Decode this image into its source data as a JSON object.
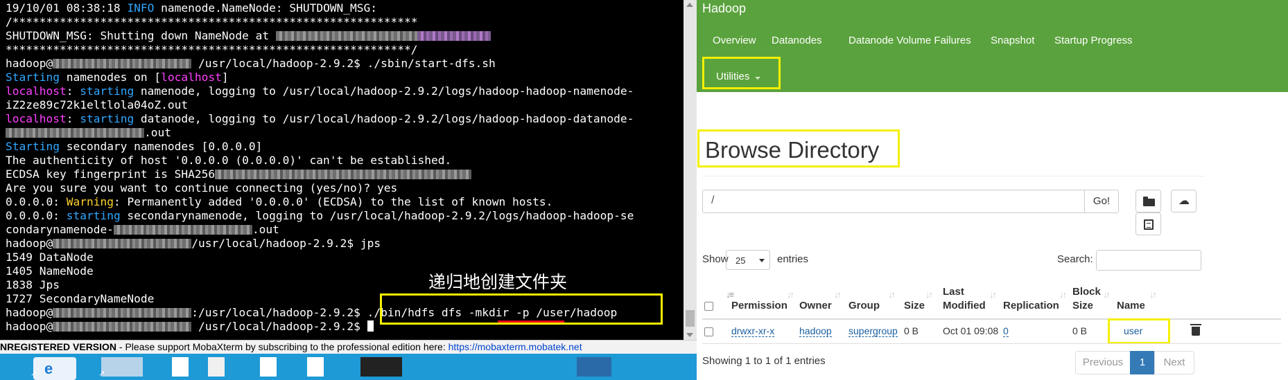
{
  "terminal": {
    "lines": {
      "l1": {
        "pre": "19/10/01 08:38:18 ",
        "info": "INFO",
        "rest": " namenode.NameNode: SHUTDOWN_MSG:"
      },
      "l2": "/************************************************************",
      "l3": "SHUTDOWN_MSG: Shutting down NameNode at ",
      "l4": "************************************************************/",
      "l5": {
        "user": "hadoop@",
        "path": " /usr/local/hadoop-2.9.2$ ./sbin/start-dfs.sh"
      },
      "l6": {
        "starting": "Starting",
        "mid": " namenodes on [",
        "host": "localhost",
        "end": "]"
      },
      "l7": {
        "host": "localhost",
        "sep": ": ",
        "starting": "starting",
        "rest": " namenode, logging to /usr/local/hadoop-2.9.2/logs/hadoop-hadoop-namenode-"
      },
      "l8": "iZ2ze89c72k1eltlola04oZ.out",
      "l9": {
        "host": "localhost",
        "sep": ": ",
        "starting": "starting",
        "rest": " datanode, logging to /usr/local/hadoop-2.9.2/logs/hadoop-hadoop-datanode-"
      },
      "l10": ".out",
      "l11": {
        "starting": "Starting",
        "rest": " secondary namenodes [0.0.0.0]"
      },
      "l12": "The authenticity of host '0.0.0.0 (0.0.0.0)' can't be established.",
      "l13": "ECDSA key fingerprint is SHA256",
      "l14": "Are you sure you want to continue connecting (yes/no)? yes",
      "l15": {
        "pre": "0.0.0.0: ",
        "warning": "Warning",
        "rest": ": Permanently added '0.0.0.0' (ECDSA) to the list of known hosts."
      },
      "l16": {
        "pre": "0.0.0.0: ",
        "starting": "starting",
        "rest": " secondarynamenode, logging to /usr/local/hadoop-2.9.2/logs/hadoop-hadoop-se"
      },
      "l17": {
        "pre": "condarynamenode-",
        "rest": ".out"
      },
      "l18": {
        "user": "hadoop@",
        "path": "/usr/local/hadoop-2.9.2$ jps"
      },
      "l19": "1549 DataNode",
      "l20": "1405 NameNode",
      "l21": "1838 Jps",
      "l22": "1727 SecondaryNameNode",
      "l23": {
        "user": "hadoop@",
        "path": ":/usr/local/hadoop-2.9.2$ ./bin/hdfs dfs -mkdir -p /user/hadoop"
      },
      "l24": {
        "user": "hadoop@",
        "path": " /usr/local/hadoop-2.9.2$ "
      }
    },
    "annotation": "递归地创建文件夹"
  },
  "status_bar": {
    "unregistered": "NREGISTERED VERSION",
    "message": "  -  Please support MobaXterm by subscribing to the professional edition here:  ",
    "url": "https://mobaxterm.mobatek.net"
  },
  "hadoop": {
    "brand": "Hadoop",
    "nav": [
      "Overview",
      "Datanodes",
      "Datanode Volume Failures",
      "Snapshot",
      "Startup Progress"
    ],
    "utilities": "Utilities",
    "page_title": "Browse Directory",
    "path_value": "/",
    "go_label": "Go!",
    "show_label": "Show",
    "entries_value": "25",
    "entries_label": "entries",
    "search_label": "Search:",
    "columns": {
      "permission": "Permission",
      "owner": "Owner",
      "group": "Group",
      "size": "Size",
      "last": "Last",
      "modified": "Modified",
      "replication": "Replication",
      "block": "Block",
      "block_size": "Size",
      "name": "Name"
    },
    "row": {
      "permission": "drwxr-xr-x",
      "owner": "hadoop",
      "group": "supergroup",
      "size": "0 B",
      "modified": "Oct 01 09:08",
      "replication": "0",
      "block_size": "0 B",
      "name": "user"
    },
    "info": "Showing 1 to 1 of 1 entries",
    "pagination": {
      "previous": "Previous",
      "page": "1",
      "next": "Next"
    }
  },
  "colors": {
    "navbar": "#5aa23d",
    "highlight": "#f5f000",
    "terminal_cyan": "#31a8ff",
    "terminal_magenta": "#ff40ff",
    "terminal_yellow": "#ffd42a",
    "link_blue": "#1a5fa0"
  },
  "icons": [
    "new-folder-icon",
    "upload-icon",
    "list-icon",
    "trash-icon"
  ]
}
